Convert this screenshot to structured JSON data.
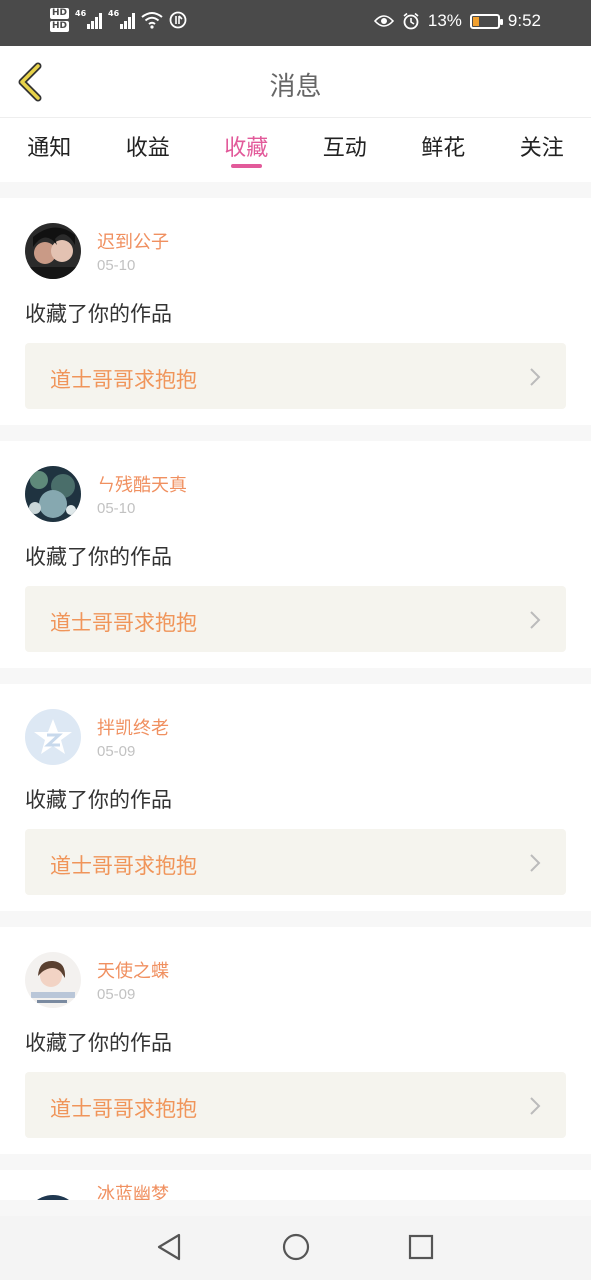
{
  "status_bar": {
    "hd1": "HD",
    "hd2": "HD",
    "net1": "46",
    "net2": "46",
    "battery_percent": "13%",
    "time": "9:52",
    "icons": [
      "signal-icon",
      "wifi-icon",
      "data-saver-icon",
      "eye-icon",
      "alarm-icon",
      "battery-icon"
    ]
  },
  "header": {
    "title": "消息",
    "back_icon": "chevron-left-icon",
    "accent_color": "#c9a227"
  },
  "tabs": [
    {
      "label": "通知",
      "active": false
    },
    {
      "label": "收益",
      "active": false
    },
    {
      "label": "收藏",
      "active": true
    },
    {
      "label": "互动",
      "active": false
    },
    {
      "label": "鲜花",
      "active": false
    },
    {
      "label": "关注",
      "active": false
    }
  ],
  "active_tab_color": "#e25a9a",
  "messages": [
    {
      "name": "迟到公子",
      "date": "05-10",
      "action": "收藏了你的作品",
      "work": "道士哥哥求抱抱"
    },
    {
      "name": "ㄣ残酷天真",
      "date": "05-10",
      "action": "收藏了你的作品",
      "work": "道士哥哥求抱抱"
    },
    {
      "name": "拌凯终老",
      "date": "05-09",
      "action": "收藏了你的作品",
      "work": "道士哥哥求抱抱"
    },
    {
      "name": "天使之蝶",
      "date": "05-09",
      "action": "收藏了你的作品",
      "work": "道士哥哥求抱抱"
    },
    {
      "name": "冰蓝幽梦",
      "date": "",
      "action": "",
      "work": ""
    }
  ],
  "nav_bar": {
    "icons": [
      "back-triangle-icon",
      "home-circle-icon",
      "recents-square-icon"
    ]
  }
}
